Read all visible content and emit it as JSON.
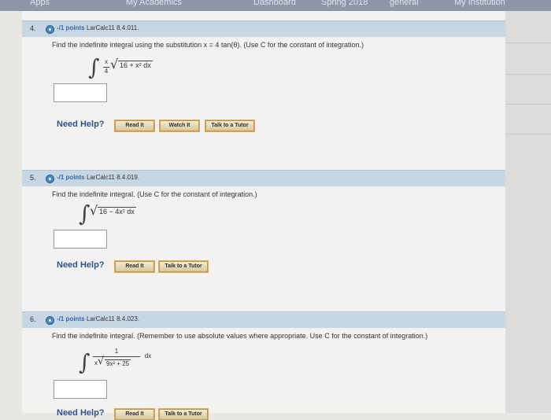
{
  "browser": {
    "bookmarks": [
      "Apps",
      "My Academics",
      "Dashboard",
      "Spring 2018",
      "general",
      "My Institution"
    ]
  },
  "questions": [
    {
      "number": "4.",
      "points": "-/1 points",
      "source": "LarCalc11 8.4.011.",
      "prompt": "Find the indefinite integral using the substitution x = 4 tan(θ). (Use C for the constant of integration.)",
      "integrand": {
        "frac_num": "x",
        "frac_den": "4",
        "radicand": "16 + x² dx"
      },
      "need_help": "Need Help?",
      "buttons": [
        "Read It",
        "Watch It",
        "Talk to a Tutor"
      ]
    },
    {
      "number": "5.",
      "points": "-/1 points",
      "source": "LarCalc11 8.4.019.",
      "prompt": "Find the indefinite integral. (Use C for the constant of integration.)",
      "integrand": {
        "radicand": "16 − 4x² dx"
      },
      "need_help": "Need Help?",
      "buttons": [
        "Read It",
        "Talk to a Tutor"
      ]
    },
    {
      "number": "6.",
      "points": "-/1 points",
      "source": "LarCalc11 8.4.023.",
      "prompt": "Find the indefinite integral. (Remember to use absolute values where appropriate. Use C for the constant of integration.)",
      "integrand": {
        "frac_num": "1",
        "den_x": "x",
        "radicand": "9x² + 25",
        "dx": "dx"
      },
      "need_help": "Need Help?",
      "buttons": [
        "Read It",
        "Talk to a Tutor"
      ]
    }
  ]
}
